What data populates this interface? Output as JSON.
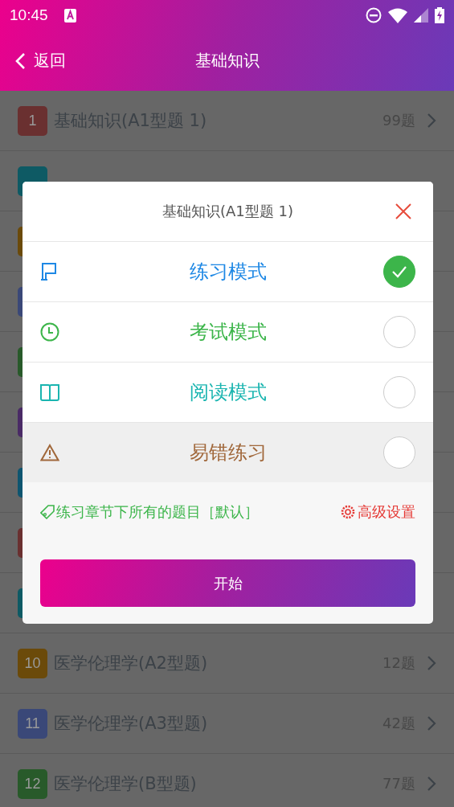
{
  "status_bar": {
    "time": "10:45"
  },
  "header": {
    "back": "返回",
    "title": "基础知识"
  },
  "list": [
    {
      "number": "1",
      "title": "基础知识(A1型题 1)",
      "count": "99题",
      "color": "#6a3030"
    },
    {
      "color": "#0e5a64"
    },
    {
      "color": "#6b4a0a"
    },
    {
      "color": "#3a4878"
    },
    {
      "color": "#285a2a"
    },
    {
      "color": "#4a2a66"
    },
    {
      "color": "#0e5570"
    },
    {
      "color": "#6a3030"
    },
    {
      "color": "#0e5a64"
    },
    {
      "number": "10",
      "title": "医学伦理学(A2型题)",
      "count": "12题",
      "color": "#6b4a0a"
    },
    {
      "number": "11",
      "title": "医学伦理学(A3型题)",
      "count": "42题",
      "color": "#3a4878"
    },
    {
      "number": "12",
      "title": "医学伦理学(B型题)",
      "count": "77题",
      "color": "#285a2a"
    }
  ],
  "dialog": {
    "title": "基础知识(A1型题 1)",
    "modes": [
      {
        "kind": "flag",
        "label": "练习模式",
        "color": "#1e88e5",
        "selected": true,
        "highlighted": false
      },
      {
        "kind": "clock",
        "label": "考试模式",
        "color": "#3cb54a",
        "selected": false,
        "highlighted": false
      },
      {
        "kind": "book",
        "label": "阅读模式",
        "color": "#1ab5b0",
        "selected": false,
        "highlighted": false
      },
      {
        "kind": "warning",
        "label": "易错练习",
        "color": "#a0673a",
        "selected": false,
        "highlighted": true
      }
    ],
    "scope": "练习章节下所有的题目［默认］",
    "advanced": "高级设置",
    "start": "开始"
  }
}
